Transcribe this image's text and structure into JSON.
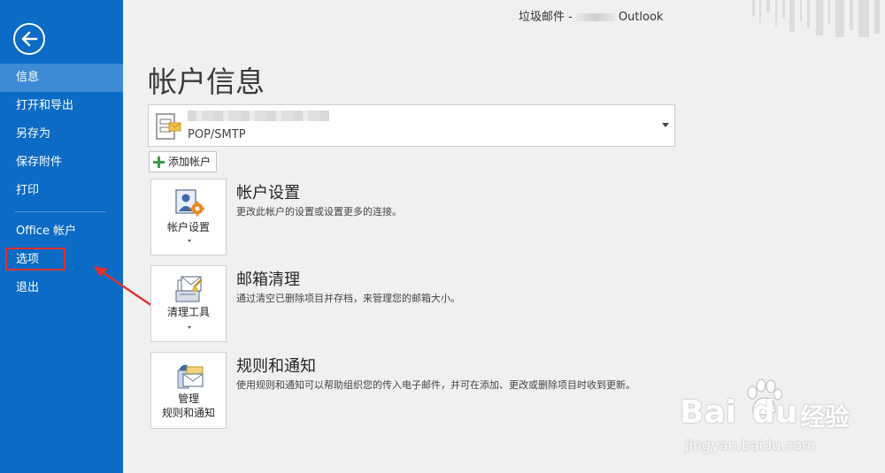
{
  "window": {
    "title_prefix": "垃圾邮件 -",
    "title_suffix": "Outlook"
  },
  "sidebar": {
    "items": [
      {
        "label": "信息",
        "active": true
      },
      {
        "label": "打开和导出"
      },
      {
        "label": "另存为"
      },
      {
        "label": "保存附件"
      },
      {
        "label": "打印"
      },
      {
        "label": "Office 帐户"
      },
      {
        "label": "选项"
      },
      {
        "label": "退出"
      }
    ],
    "highlighted_item": "选项",
    "colors": {
      "background": "#0b6bc5",
      "active": "#3d8bd6",
      "highlight_box": "#e2312e"
    }
  },
  "main": {
    "page_title": "帐户信息",
    "account": {
      "type": "POP/SMTP"
    },
    "add_account_label": "添加帐户",
    "sections": [
      {
        "tile_label": "帐户设置",
        "title": "帐户设置",
        "description": "更改此帐户的设置或设置更多的连接。",
        "icon": "account-settings-icon"
      },
      {
        "tile_label": "清理工具",
        "title": "邮箱清理",
        "description": "通过清空已删除项目并存档，来管理您的邮箱大小。",
        "icon": "cleanup-tools-icon"
      },
      {
        "tile_label_line1": "管理",
        "tile_label_line2": "规则和通知",
        "title": "规则和通知",
        "description": "使用规则和通知可以帮助组织您的传入电子邮件，并可在添加、更改或删除项目时收到更新。",
        "icon": "rules-alerts-icon"
      }
    ]
  },
  "watermark": {
    "brand": "Bai",
    "brand2": "du",
    "site_cn": "经验",
    "url": "jingyan.baidu.com"
  }
}
